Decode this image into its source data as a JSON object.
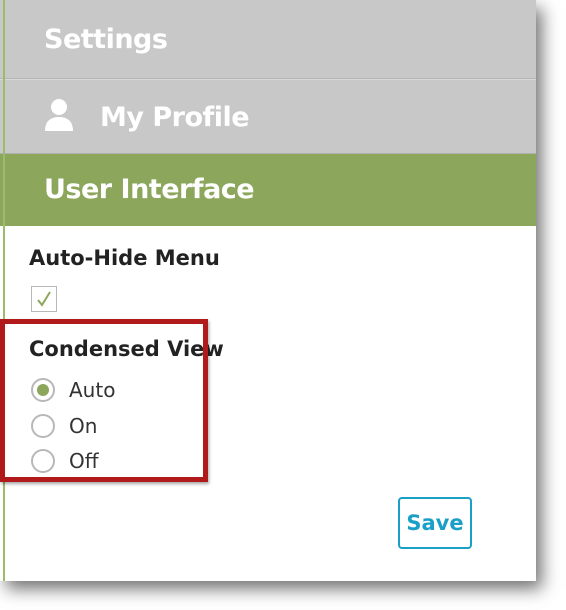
{
  "header": {
    "title": "Settings"
  },
  "menu": {
    "profile_label": "My Profile",
    "profile_icon": "user-icon",
    "ui_label": "User Interface"
  },
  "form": {
    "auto_hide_label": "Auto-Hide Menu",
    "auto_hide_checked": true,
    "condensed_label": "Condensed View",
    "options": [
      {
        "label": "Auto",
        "selected": true
      },
      {
        "label": "On",
        "selected": false
      },
      {
        "label": "Off",
        "selected": false
      }
    ],
    "save_label": "Save"
  },
  "colors": {
    "accent_green": "#8ca75c",
    "header_gray": "#c8c8c8",
    "save_blue": "#1aa0c8",
    "highlight_red": "#b01a1a"
  }
}
